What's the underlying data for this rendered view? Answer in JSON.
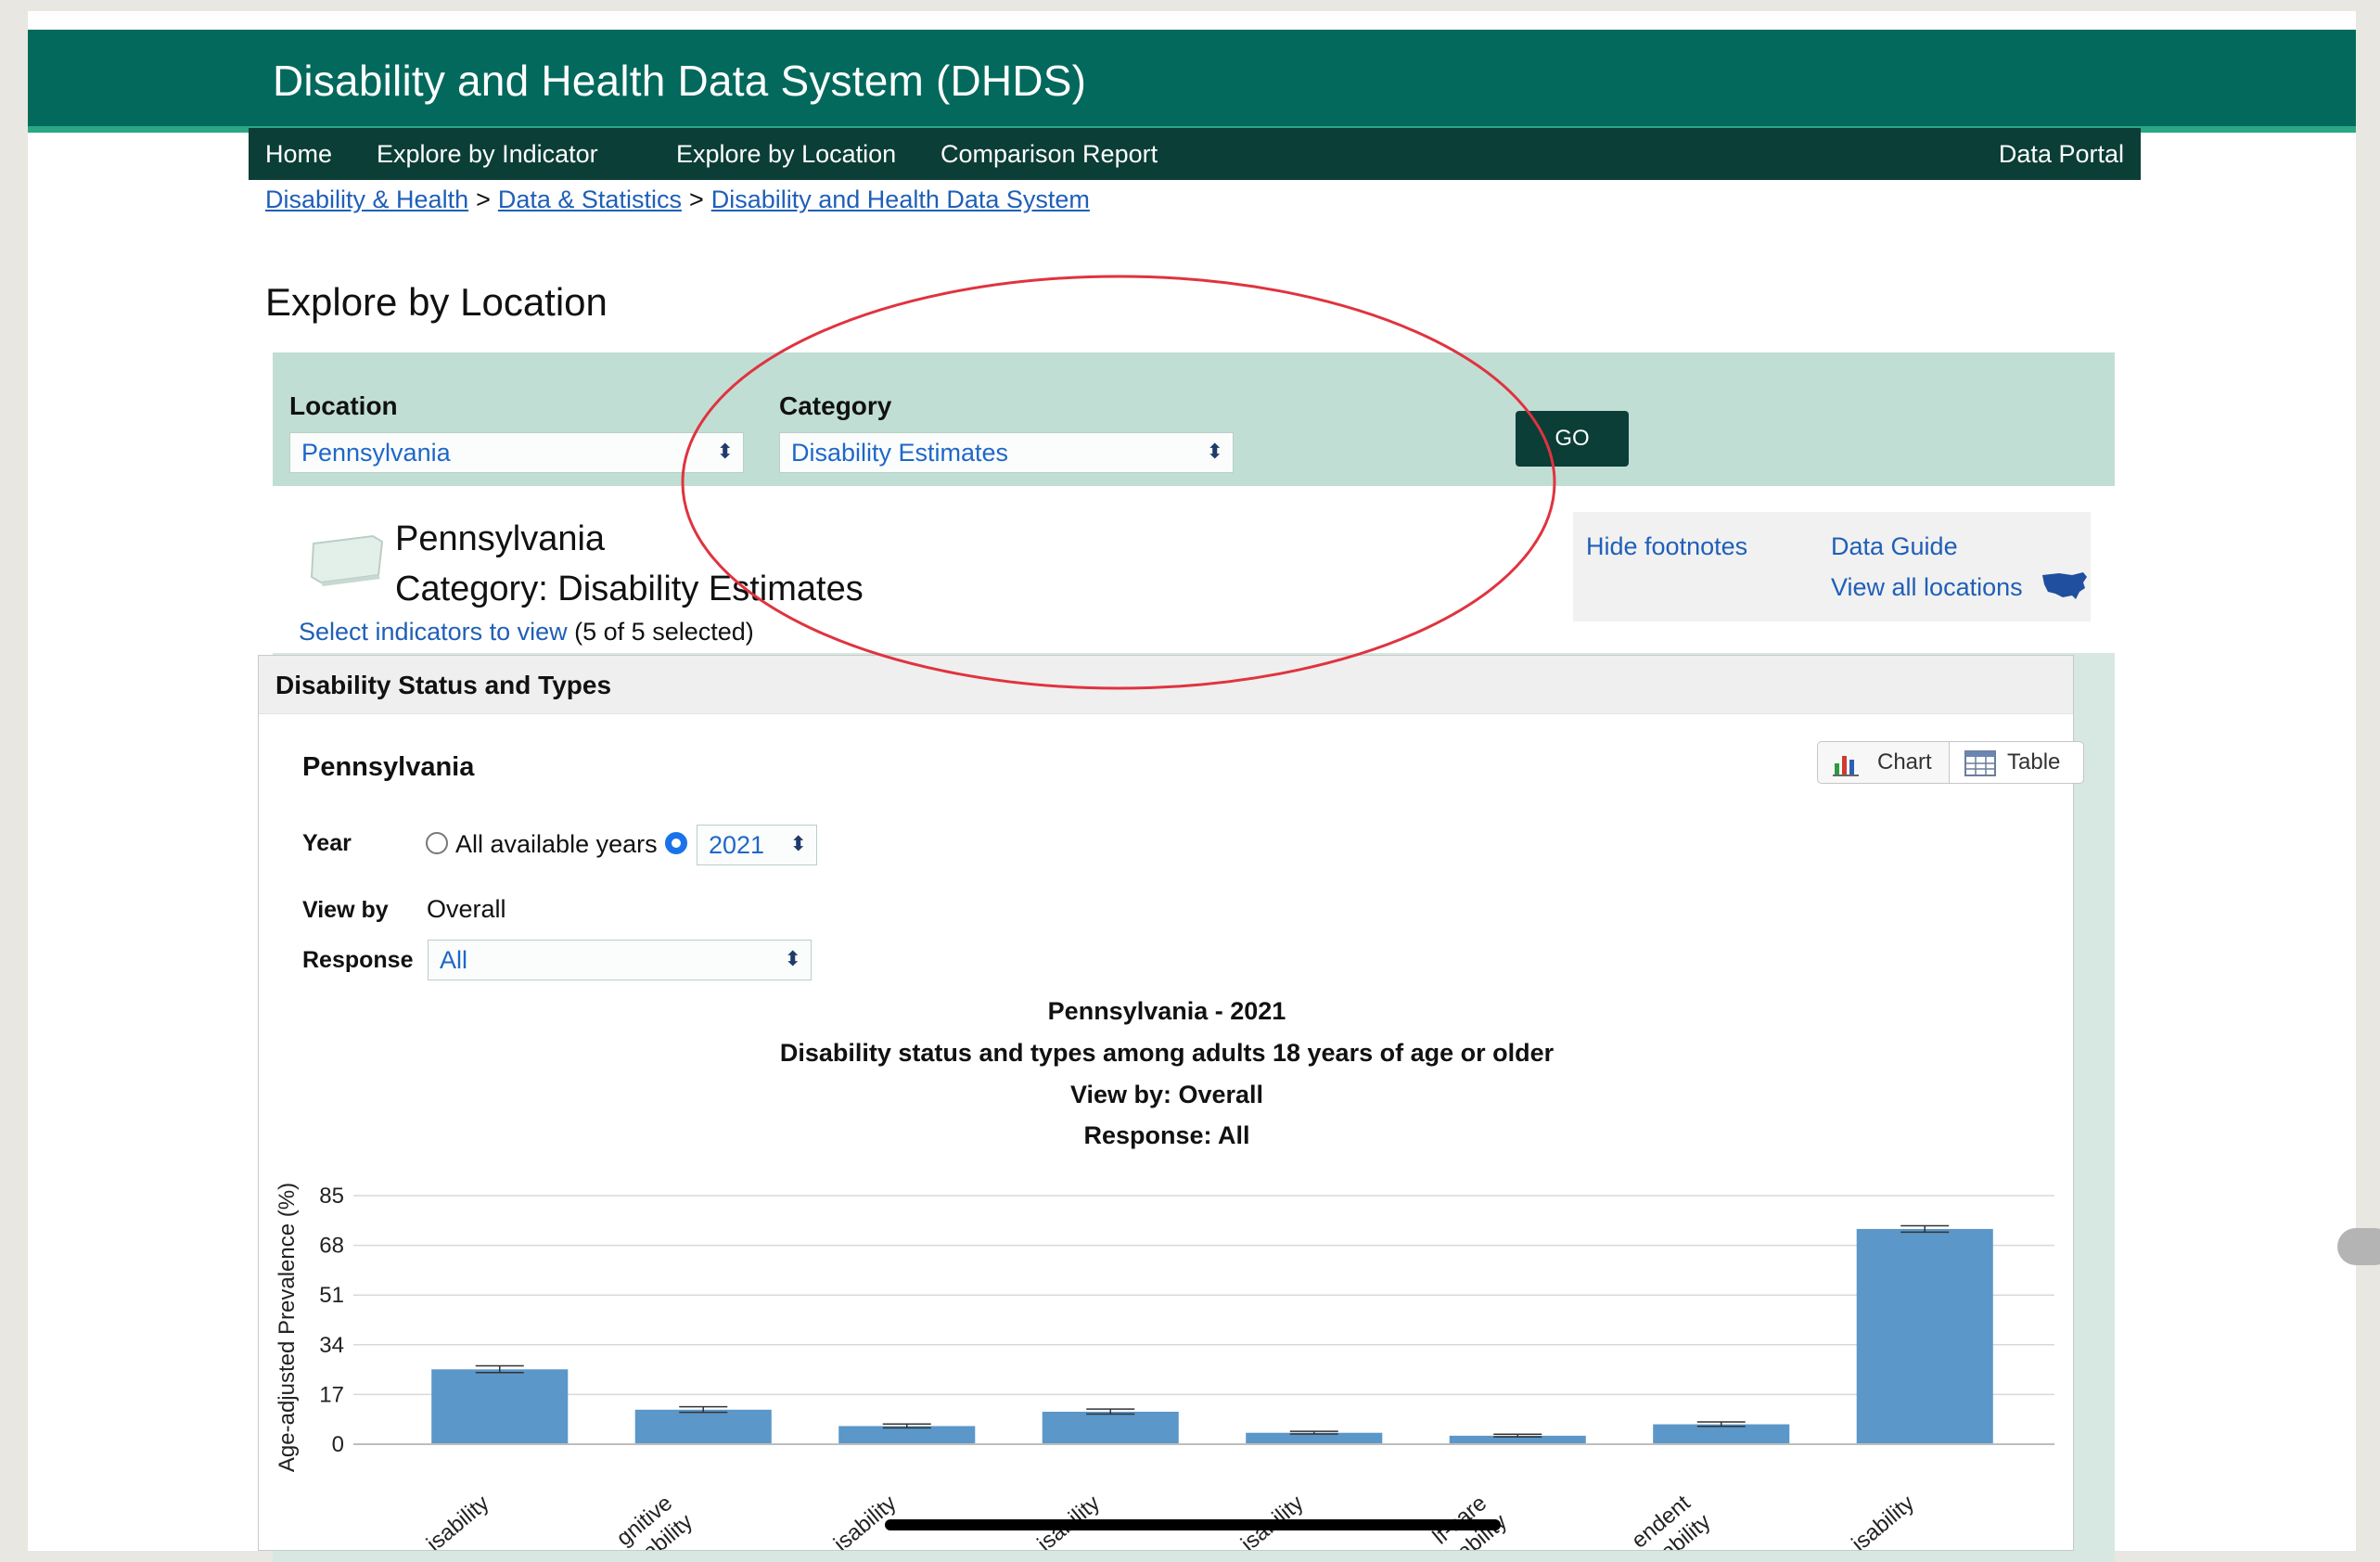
{
  "header": {
    "title": "Disability and Health Data System (DHDS)"
  },
  "nav": {
    "items": [
      "Home",
      "Explore by Indicator",
      "Explore by Location",
      "Comparison Report"
    ],
    "right": "Data Portal"
  },
  "breadcrumb": [
    "Disability & Health",
    "Data & Statistics",
    "Disability and Health Data System"
  ],
  "page_title": "Explore by Location",
  "filters": {
    "location_label": "Location",
    "location_value": "Pennsylvania",
    "category_label": "Category",
    "category_value": "Disability Estimates",
    "go_label": "GO"
  },
  "location_info": {
    "name": "Pennsylvania",
    "category": "Category: Disability Estimates",
    "select_link": "Select indicators to view",
    "selected_count": "(5 of 5 selected)"
  },
  "side_links": {
    "hide_footnotes": "Hide footnotes",
    "data_guide": "Data Guide",
    "view_all": "View all locations"
  },
  "panel": {
    "header": "Disability Status and Types",
    "location": "Pennsylvania",
    "toggle": {
      "chart": "Chart",
      "table": "Table"
    },
    "year_label": "Year",
    "all_years_label": "All available years",
    "year_value": "2021",
    "viewby_label": "View by",
    "viewby_value": "Overall",
    "response_label": "Response",
    "response_value": "All"
  },
  "colors": {
    "banner": "#03695c",
    "nav": "#0a3e36",
    "bar": "#5b97c9",
    "annotation": "#e0333f"
  },
  "chart_data": {
    "type": "bar",
    "title_lines": [
      "Pennsylvania - 2021",
      "Disability status and types among adults 18 years of age or older",
      "View by: Overall",
      "Response: All"
    ],
    "ylabel": "Age-adjusted Prevalence (%)",
    "ylim": [
      0,
      85
    ],
    "yticks": [
      0,
      17,
      34,
      51,
      68,
      85
    ],
    "categories": [
      "Any Disability",
      "Cognitive Disability",
      "Hearing Disability",
      "Mobility Disability",
      "Vision Disability",
      "Self-care Disability",
      "Independent Living Disability",
      "No Disability"
    ],
    "category_labels": [
      [
        "isability"
      ],
      [
        "gnitive",
        "sability"
      ],
      [
        "isability"
      ],
      [
        "isability"
      ],
      [
        "isability"
      ],
      [
        "lf-care",
        "isability"
      ],
      [
        "endent",
        "isability"
      ],
      [
        "isability"
      ]
    ],
    "values": [
      25.6,
      11.8,
      6.2,
      11.1,
      3.9,
      2.9,
      6.8,
      73.6
    ],
    "error_low": [
      24.5,
      10.9,
      5.6,
      10.3,
      3.5,
      2.5,
      6.1,
      72.5
    ],
    "error_high": [
      26.8,
      12.8,
      6.9,
      12.0,
      4.4,
      3.4,
      7.6,
      74.7
    ],
    "grid": true
  }
}
